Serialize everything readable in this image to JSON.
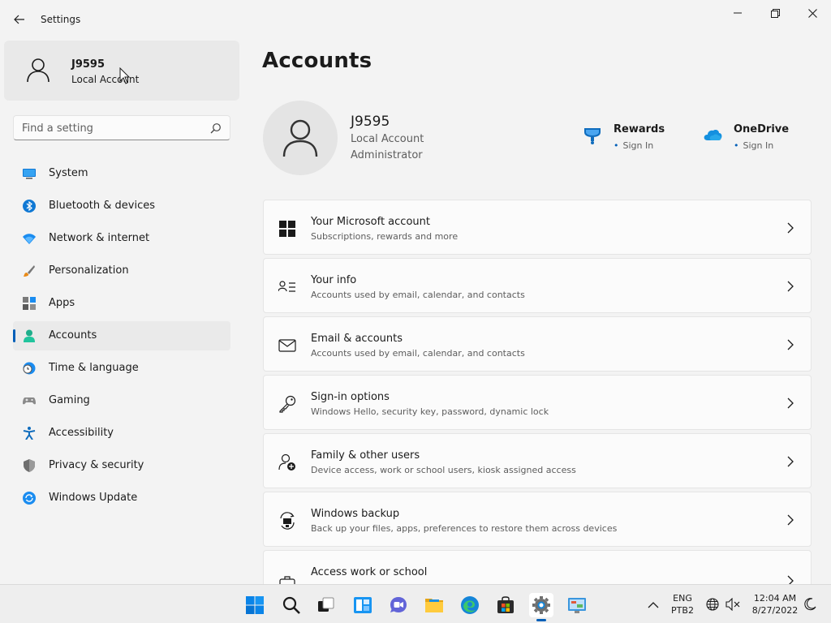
{
  "window": {
    "title": "Settings"
  },
  "user": {
    "name": "J9595",
    "type": "Local Account"
  },
  "search": {
    "placeholder": "Find a setting"
  },
  "nav": [
    {
      "label": "System",
      "icon": "monitor-icon"
    },
    {
      "label": "Bluetooth & devices",
      "icon": "bluetooth-icon"
    },
    {
      "label": "Network & internet",
      "icon": "wifi-icon"
    },
    {
      "label": "Personalization",
      "icon": "brush-icon"
    },
    {
      "label": "Apps",
      "icon": "apps-icon"
    },
    {
      "label": "Accounts",
      "icon": "person-icon",
      "active": true
    },
    {
      "label": "Time & language",
      "icon": "clock-globe-icon"
    },
    {
      "label": "Gaming",
      "icon": "gamepad-icon"
    },
    {
      "label": "Accessibility",
      "icon": "accessibility-icon"
    },
    {
      "label": "Privacy & security",
      "icon": "shield-icon"
    },
    {
      "label": "Windows Update",
      "icon": "update-icon"
    }
  ],
  "main": {
    "title": "Accounts",
    "account": {
      "name": "J9595",
      "type": "Local Account",
      "role": "Administrator"
    },
    "services": [
      {
        "name": "Rewards",
        "link": "Sign In",
        "icon": "rewards-trophy-icon"
      },
      {
        "name": "OneDrive",
        "link": "Sign In",
        "icon": "onedrive-cloud-icon"
      }
    ],
    "cards": [
      {
        "title": "Your Microsoft account",
        "subtitle": "Subscriptions, rewards and more",
        "icon": "windows-logo-icon"
      },
      {
        "title": "Your info",
        "subtitle": "Accounts used by email, calendar, and contacts",
        "icon": "contact-card-icon"
      },
      {
        "title": "Email & accounts",
        "subtitle": "Accounts used by email, calendar, and contacts",
        "icon": "mail-icon"
      },
      {
        "title": "Sign-in options",
        "subtitle": "Windows Hello, security key, password, dynamic lock",
        "icon": "key-icon"
      },
      {
        "title": "Family & other users",
        "subtitle": "Device access, work or school users, kiosk assigned access",
        "icon": "add-person-icon"
      },
      {
        "title": "Windows backup",
        "subtitle": "Back up your files, apps, preferences to restore them across devices",
        "icon": "backup-icon"
      },
      {
        "title": "Access work or school",
        "subtitle": "",
        "icon": "briefcase-icon"
      }
    ]
  },
  "taskbar": {
    "apps": [
      "start-icon",
      "search-icon",
      "task-view-icon",
      "widgets-icon",
      "chat-icon",
      "file-explorer-icon",
      "edge-icon",
      "store-icon",
      "settings-gear-icon",
      "control-panel-icon"
    ],
    "tray": {
      "lang1": "ENG",
      "lang2": "PTB2",
      "time": "12:04 AM",
      "date": "8/27/2022"
    }
  },
  "colors": {
    "accent": "#005fb8",
    "background": "#f3f3f3",
    "card": "#fbfbfb"
  }
}
